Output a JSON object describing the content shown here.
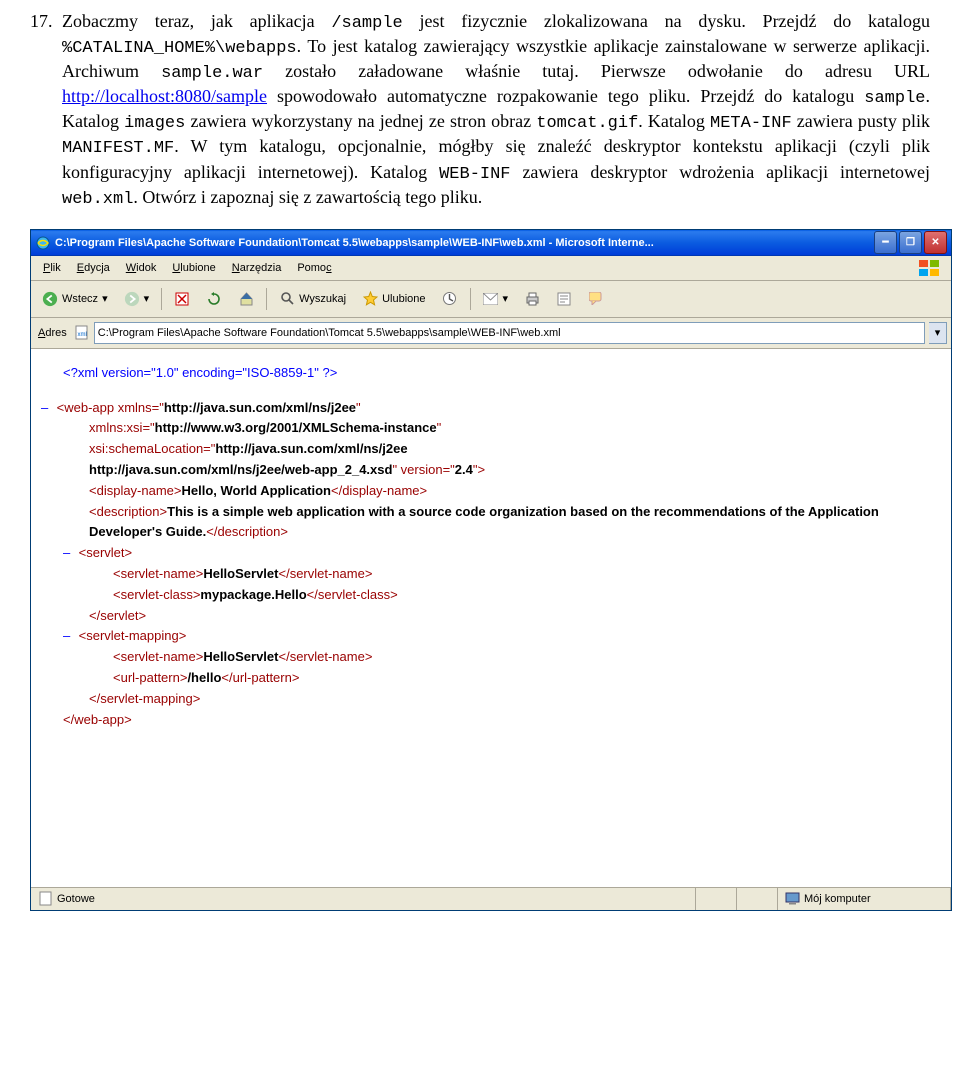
{
  "doc": {
    "number": "17.",
    "s1a": "Zobaczmy teraz, jak aplikacja ",
    "s1mono1": "/sample",
    "s1b": " jest fizycznie zlokalizowana na dysku. Przejdź do katalogu ",
    "s1mono2": "%CATALINA_HOME%\\webapps",
    "s1c": ". To jest katalog zawierający wszystkie aplikacje zainstalowane w serwerze aplikacji. Archiwum ",
    "s1mono3": "sample.war",
    "s1d": " zostało załadowane właśnie tutaj. Pierwsze odwołanie do adresu URL ",
    "s1link": "http://localhost:8080/sample",
    "s1e": " spowodowało automatyczne rozpakowanie tego pliku. Przejdź do katalogu ",
    "s1mono4": "sample",
    "s1f": ". Katalog ",
    "s1mono5": "images",
    "s1g": " zawiera wykorzystany na jednej ze stron obraz ",
    "s1mono6": "tomcat.gif",
    "s1h": ". Katalog ",
    "s1mono7": "META-INF",
    "s1i": " zawiera pusty plik ",
    "s1mono8": "MANIFEST.MF",
    "s1j": ". W tym katalogu, opcjonalnie, mógłby się znaleźć deskryptor kontekstu aplikacji (czyli plik konfiguracyjny aplikacji internetowej). Katalog ",
    "s1mono9": "WEB-INF",
    "s1k": " zawiera deskryptor wdrożenia aplikacji internetowej ",
    "s1mono10": "web.xml",
    "s1l": ". Otwórz i zapoznaj się z zawartością tego pliku."
  },
  "ie": {
    "title": "C:\\Program Files\\Apache Software Foundation\\Tomcat 5.5\\webapps\\sample\\WEB-INF\\web.xml - Microsoft Interne...",
    "menus": {
      "plik": "Plik",
      "edycja": "Edycja",
      "widok": "Widok",
      "ulubione": "Ulubione",
      "narzedzia": "Narzędzia",
      "pomoc": "Pomoc"
    },
    "toolbar": {
      "wstecz": "Wstecz",
      "wyszukaj": "Wyszukaj",
      "ulubione": "Ulubione"
    },
    "addr_label": "Adres",
    "addr_value": "C:\\Program Files\\Apache Software Foundation\\Tomcat 5.5\\webapps\\sample\\WEB-INF\\web.xml",
    "status_left": "Gotowe",
    "status_right": "Mój komputer"
  },
  "xml": {
    "pi": "<?xml version=\"1.0\" encoding=\"ISO-8859-1\" ?>",
    "webapp_open_l1": "<web-app xmlns=\"",
    "ns1": "http://java.sun.com/xml/ns/j2ee",
    "webapp_open_l1b": "\"",
    "webapp_open_l2a": "xmlns:xsi=\"",
    "ns2": "http://www.w3.org/2001/XMLSchema-instance",
    "webapp_open_l2b": "\"",
    "webapp_open_l3a": "xsi:schemaLocation=\"",
    "sl1": "http://java.sun.com/xml/ns/j2ee",
    "sl2": "http://java.sun.com/xml/ns/j2ee/web-app_2_4.xsd",
    "webapp_open_l4": "\" version=\"",
    "ver": "2.4",
    "webapp_open_end": "\">",
    "dn_open": "<display-name>",
    "dn_text": "Hello, World Application",
    "dn_close": "</display-name>",
    "desc_open": "<description>",
    "desc_text": "This is a simple web application with a source code organization based on the recommendations of the Application Developer's Guide.",
    "desc_close": "</description>",
    "servlet_open": "<servlet>",
    "sn_open": "<servlet-name>",
    "sn_text": "HelloServlet",
    "sn_close": "</servlet-name>",
    "sc_open": "<servlet-class>",
    "sc_text": "mypackage.Hello",
    "sc_close": "</servlet-class>",
    "servlet_close": "</servlet>",
    "sm_open": "<servlet-mapping>",
    "sn2_text": "HelloServlet",
    "up_open": "<url-pattern>",
    "up_text": "/hello",
    "up_close": "</url-pattern>",
    "sm_close": "</servlet-mapping>",
    "webapp_close": "</web-app>"
  }
}
